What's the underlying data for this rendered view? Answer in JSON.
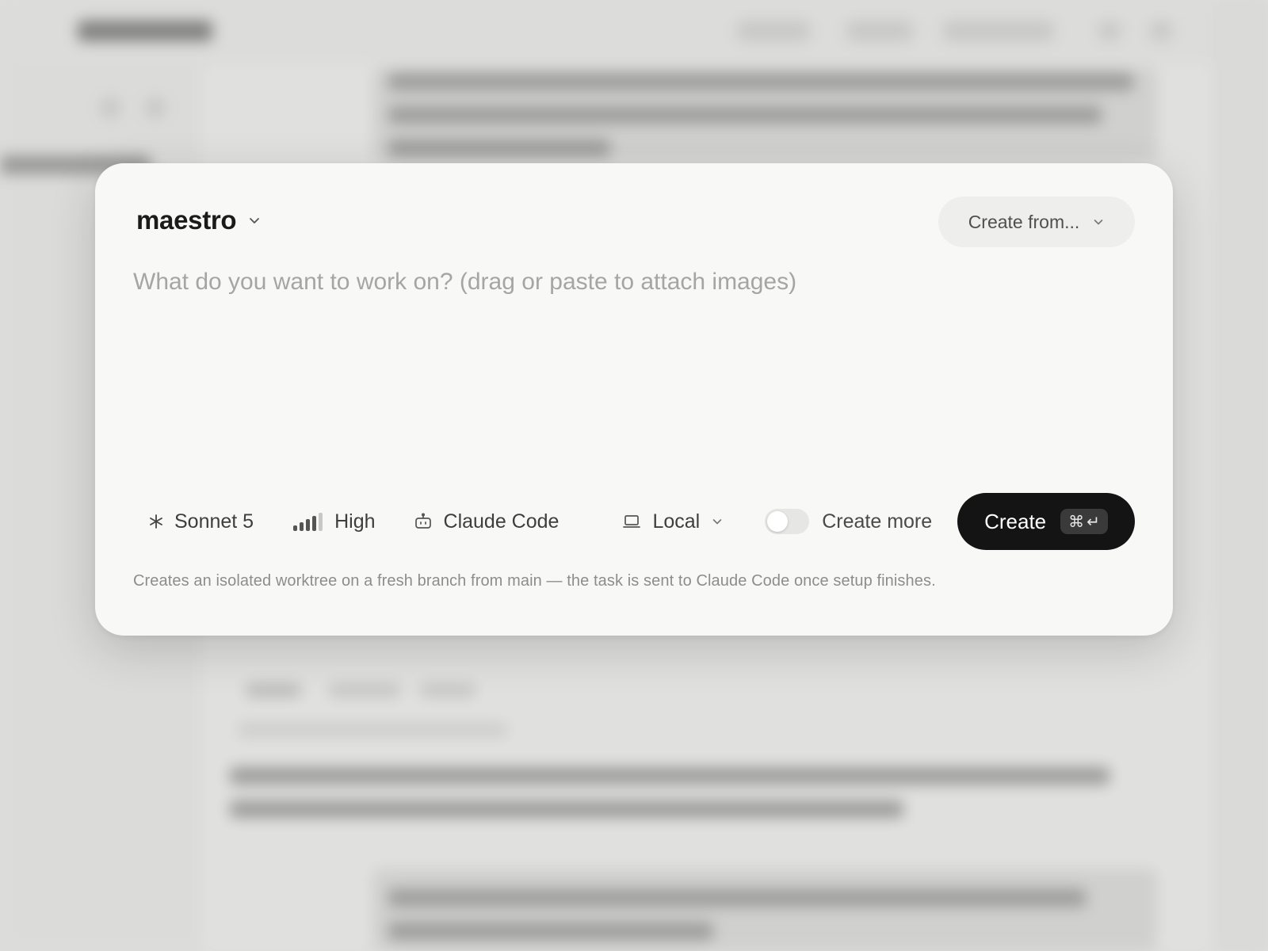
{
  "background": {
    "window_title": "maestro",
    "note": ""
  },
  "dialog": {
    "project": {
      "name": "maestro",
      "chevron_icon": "chevron-down-icon"
    },
    "create_from": {
      "label": "Create from...",
      "chevron_icon": "chevron-down-icon"
    },
    "input": {
      "value": "",
      "placeholder": "What do you want to work on? (drag or paste to attach images)"
    },
    "toolbar": {
      "model": {
        "icon": "asterisk-icon",
        "label": "Sonnet 5"
      },
      "effort": {
        "icon": "signal-bars-icon",
        "label": "High"
      },
      "agent": {
        "icon": "robot-icon",
        "label": "Claude Code"
      },
      "location": {
        "icon": "laptop-icon",
        "label": "Local",
        "chevron_icon": "chevron-down-icon"
      },
      "create_more": {
        "label": "Create more",
        "enabled": false
      }
    },
    "create_button": {
      "label": "Create",
      "shortcut_cmd": "⌘",
      "shortcut_enter": "↵"
    },
    "footnote": "Creates an isolated worktree on a fresh branch from main — the task is sent to Claude Code once setup finishes."
  },
  "colors": {
    "dialog_bg": "#f8f8f7",
    "primary_button": "#141414",
    "placeholder": "#a5a5a3"
  }
}
